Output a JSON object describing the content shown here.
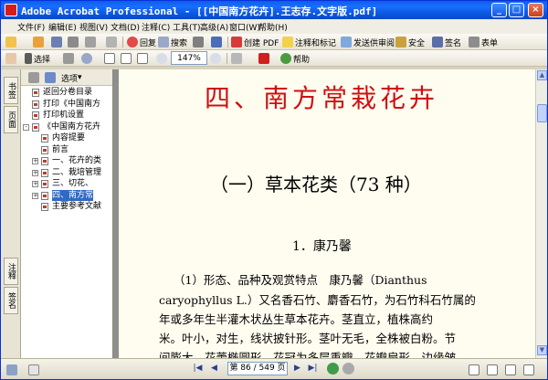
{
  "window": {
    "title": "Adobe Acrobat Professional - [[中国南方花卉].王志存.文字版.pdf]"
  },
  "menubar": {
    "items": [
      "文件(F)",
      "编辑(E)",
      "视图(V)",
      "文档(D)",
      "注释(C)",
      "工具(T)",
      "高级(A)",
      "窗口(W)",
      "帮助(H)"
    ]
  },
  "toolbar1": {
    "search_label": "搜索",
    "create_pdf_label": "创建 PDF",
    "comment_label": "注释和标记",
    "review_label": "发送供审阅",
    "secure_label": "安全",
    "sign_label": "签名",
    "forms_label": "表单"
  },
  "toolbar2": {
    "select_label": "选择",
    "zoom_value": "147%",
    "help_label": "帮助"
  },
  "nav_tabs": [
    "书签",
    "页面",
    "注释",
    "签名"
  ],
  "bookmarks": {
    "options_label": "选项",
    "items": [
      {
        "label": "返回分卷目录",
        "expand": "",
        "selected": false
      },
      {
        "label": "打印《中国南方",
        "expand": "",
        "selected": false
      },
      {
        "label": "打印机设置",
        "expand": "",
        "selected": false
      },
      {
        "label": "《中国南方花卉",
        "expand": "-",
        "selected": false
      },
      {
        "label": "内容提要",
        "expand": "",
        "selected": false
      },
      {
        "label": "前言",
        "expand": "",
        "selected": false
      },
      {
        "label": "一、花卉的类",
        "expand": "+",
        "selected": false
      },
      {
        "label": "二、栽培管理",
        "expand": "+",
        "selected": false
      },
      {
        "label": "三、切花、",
        "expand": "+",
        "selected": false
      },
      {
        "label": "四、南方常",
        "expand": "+",
        "selected": true
      },
      {
        "label": "主要参考文献",
        "expand": "",
        "selected": false
      }
    ]
  },
  "document": {
    "chapter_title": "四、南方常栽花卉",
    "section_title": "（一）草本花类（73 种）",
    "subsection_title": "1．康乃馨",
    "lines": [
      "（1）形态、品种及观赏特点　康乃馨（Dianthus",
      "caryophyllus L.）又名香石竹、麝香石竹，为石竹科石竹属的",
      "年或多年生半灌木状丛生草本花卉。茎直立，植株高约",
      "米。叶小，对生，线状披针形。茎叶无毛，全株被白粉。节",
      "间膨大　花蕾椭圆形　花冠为多层重瓣　花瓣扇形　边缘皱"
    ]
  },
  "statusbar": {
    "page_display": "第 86 / 549 页"
  },
  "colors": {
    "title_red": "#d10f0f",
    "xp_blue": "#0a5fe8",
    "page_bg": "#fffdf0"
  }
}
